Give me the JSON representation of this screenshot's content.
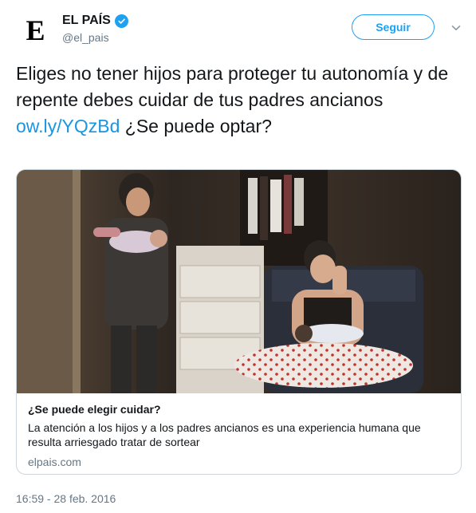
{
  "account": {
    "display_name": "EL PAÍS",
    "handle": "@el_pais",
    "avatar_letter": "E",
    "verified_icon": "verified-badge-icon"
  },
  "header": {
    "follow_label": "Seguir",
    "more_icon": "chevron-down-icon"
  },
  "tweet": {
    "text_before_link": "Eliges no tener hijos para proteger tu autonomía y de repente debes cuidar de tus padres ancianos ",
    "link": "ow.ly/YQzBd",
    "text_after_link": " ¿Se puede optar?"
  },
  "card": {
    "title": "¿Se puede elegir cuidar?",
    "description": "La atención a los hijos y a los padres ancianos es una experiencia humana que resulta arriesgado tratar de sortear",
    "domain": "elpais.com"
  },
  "timestamp": "16:59 - 28 feb. 2016",
  "colors": {
    "accent": "#1da1f2",
    "link": "#1b95e0",
    "secondary_text": "#657786",
    "border": "#ccd6dd"
  }
}
